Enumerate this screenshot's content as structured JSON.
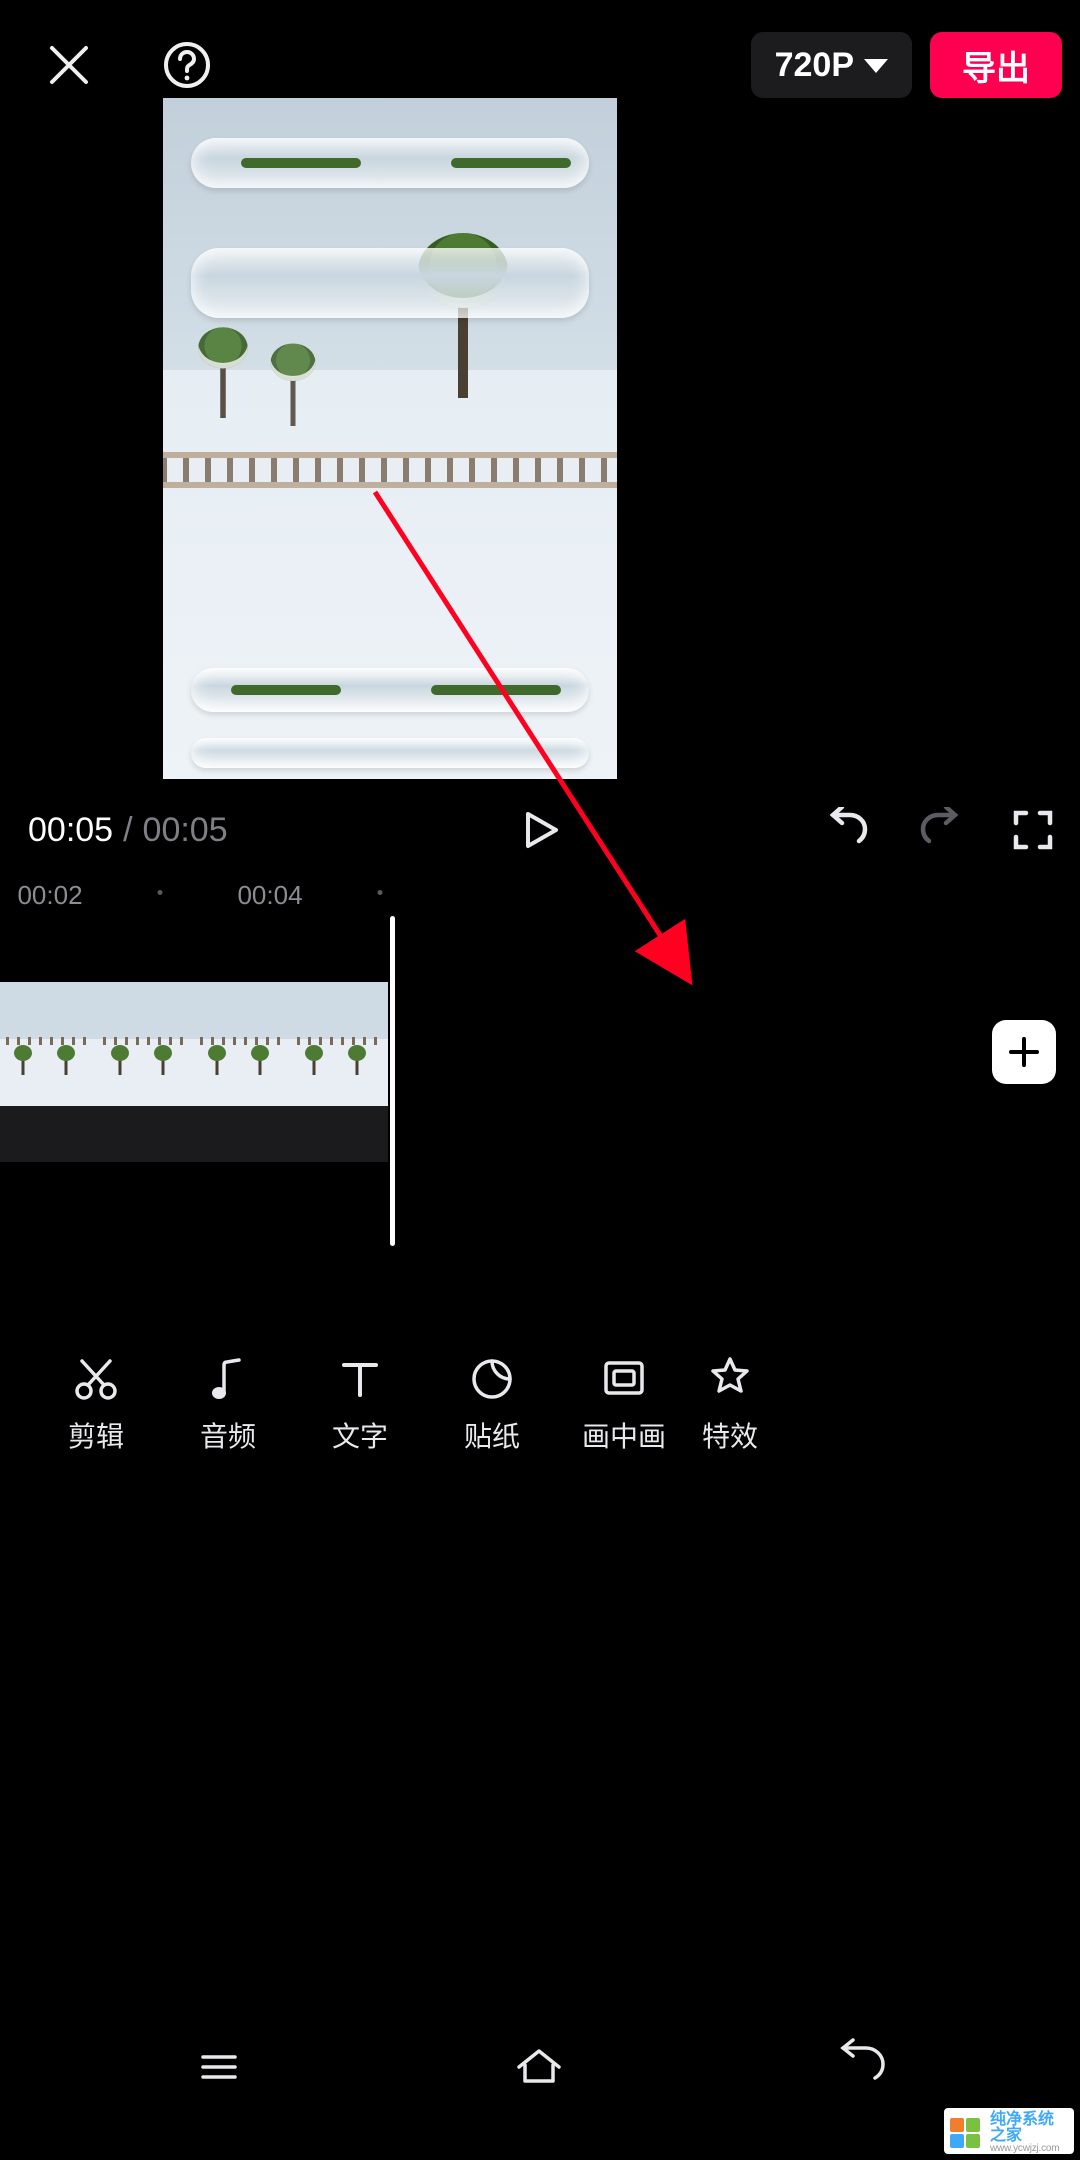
{
  "top": {
    "resolution": "720P",
    "export": "导出"
  },
  "playback": {
    "current": "00:05",
    "separator": "/",
    "total": "00:05"
  },
  "timeline": {
    "ruler": [
      "00:02",
      "00:04"
    ]
  },
  "tools": {
    "items": [
      {
        "id": "cut",
        "label": "剪辑"
      },
      {
        "id": "audio",
        "label": "音频"
      },
      {
        "id": "text",
        "label": "文字"
      },
      {
        "id": "sticker",
        "label": "贴纸"
      },
      {
        "id": "pip",
        "label": "画中画"
      },
      {
        "id": "effect",
        "label": "特效"
      }
    ]
  },
  "icons": {
    "close": "close-icon",
    "help": "help-icon",
    "play": "play-icon",
    "undo": "undo-icon",
    "redo": "redo-icon",
    "fullscreen": "fullscreen-icon",
    "add": "plus-icon",
    "nav_menu": "nav-menu-icon",
    "nav_home": "nav-home-icon",
    "nav_back": "nav-back-icon"
  },
  "watermark": {
    "line1": "纯净系统之家",
    "line2": "www.ycwjzj.com"
  },
  "colors": {
    "accent": "#ff0050",
    "pill": "#1c1c1e"
  }
}
